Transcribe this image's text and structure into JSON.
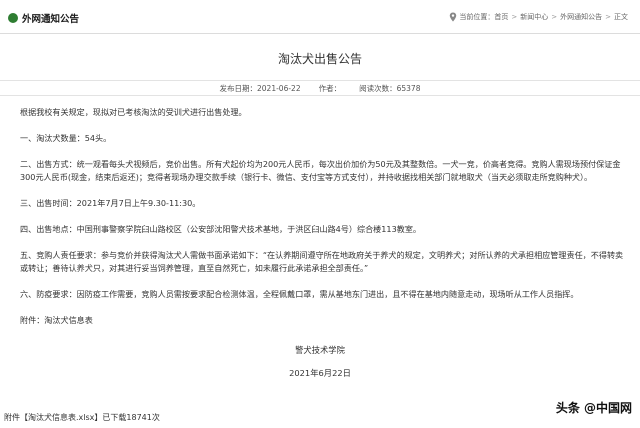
{
  "header": {
    "section_title": "外网通知公告",
    "breadcrumb": {
      "prefix": "当前位置：",
      "items": [
        "首页",
        "新闻中心",
        "外网通知公告",
        "正文"
      ],
      "separator": ">"
    }
  },
  "article": {
    "title": "淘汰犬出售公告",
    "publish_label": "发布日期：2021-06-22",
    "author_label": "作者：",
    "views_label": "阅读次数：65378",
    "paragraphs": [
      "根据我校有关规定，现拟对已考核淘汰的受训犬进行出售处理。",
      "一、淘汰犬数量：54头。",
      "二、出售方式：统一观看每头犬视频后，竞价出售。所有犬起价均为200元人民币，每次出价加价为50元及其整数倍。一犬一竞，价高者竞得。竞购人需现场预付保证金300元人民币(现金，结束后返还)；竞得者现场办理交款手续（银行卡、微信、支付宝等方式支付），并持收据找相关部门就地取犬（当天必须取走所竞购种犬）。",
      "三、出售时间：2021年7月7日上午9.30-11:30。",
      "四、出售地点：中国刑事警察学院臼山路校区（公安部沈阳警犬技术基地，于洪区臼山路4号）综合楼113教室。",
      "五、竞购人责任要求：参与竞价并获得淘汰犬人需做书面承诺如下：“在认养期间遵守所在地政府关于养犬的规定，文明养犬；对所认养的犬承担相应管理责任，不得转卖或转让；善待认养犬只，对其进行妥当饲养管理，直至自然死亡，如未履行此承诺承担全部责任。”",
      "六、防疫要求：因防疫工作需要，竞购人员需按要求配合检测体温，全程佩戴口罩，需从基地东门进出，且不得在基地内随意走动，现场听从工作人员指挥。",
      "附件：淘汰犬信息表"
    ],
    "signature": "警犬技术学院",
    "date": "2021年6月22日"
  },
  "attachment": {
    "prefix": "附件【",
    "filename": "淘汰犬信息表.xlsx",
    "suffix": "】已下载18741次"
  },
  "watermark": "头条 @中国网",
  "colors": {
    "accent": "#2e7d32",
    "border": "#dcdcdc"
  }
}
